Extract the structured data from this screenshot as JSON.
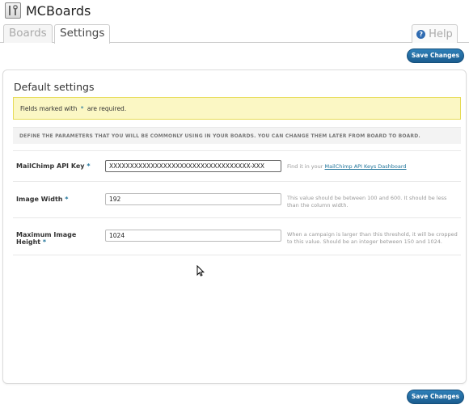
{
  "app": {
    "title": "MCBoards",
    "logo_icon": "tools-icon"
  },
  "tabs": [
    {
      "label": "Boards",
      "active": false
    },
    {
      "label": "Settings",
      "active": true
    }
  ],
  "help": {
    "label": "Help",
    "icon": "help-icon"
  },
  "toolbar": {
    "save_label": "Save Changes"
  },
  "settings": {
    "title": "Default settings",
    "notice": {
      "prefix": "Fields marked with",
      "star": "*",
      "suffix": "are required."
    },
    "description": "DEFINE THE PARAMETERS THAT YOU WILL BE COMMONLY USING IN YOUR BOARDS. YOU CAN CHANGE THEM LATER FROM BOARD TO BOARD.",
    "fields": [
      {
        "label": "MailChimp API Key",
        "required": "*",
        "value": "XXXXXXXXXXXXXXXXXXXXXXXXXXXXXXXXXX-XXX",
        "help_prefix": "Find it in your",
        "help_link": "MailChimp API Keys Dashboard"
      },
      {
        "label": "Image Width",
        "required": "*",
        "value": "192",
        "help": "This value should be between 100 and 600. It should be less than the column width."
      },
      {
        "label": "Maximum Image Height",
        "required": "*",
        "value": "1024",
        "help": "When a campaign is larger than this threshold, it will be cropped to this value. Should be an integer between 150 and 1024."
      }
    ]
  },
  "colors": {
    "accent": "#21759b",
    "button": "#1f6aa3",
    "notice_bg": "#fbf7c4"
  }
}
